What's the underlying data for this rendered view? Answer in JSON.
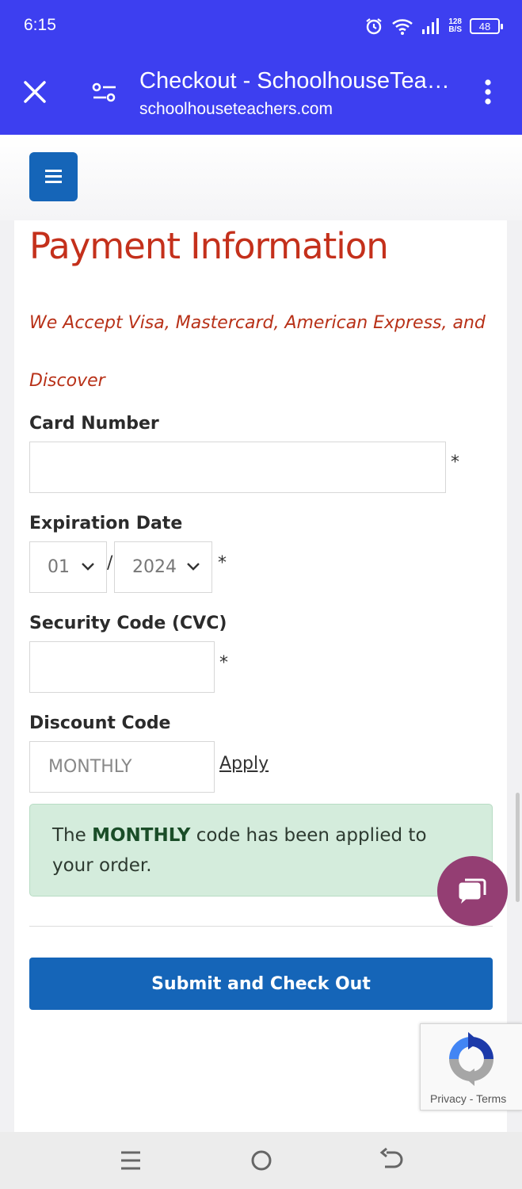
{
  "status_bar": {
    "time": "6:15",
    "net_speed_top": "128",
    "net_speed_bottom": "B/S",
    "battery": "48",
    "icons": [
      "alarm-icon",
      "wifi-icon",
      "signal-icon"
    ]
  },
  "browser": {
    "title": "Checkout - SchoolhouseTeac...",
    "url": "schoolhouseteachers.com",
    "icons": [
      "close-icon",
      "page-settings-icon",
      "more-vert-icon"
    ]
  },
  "site": {
    "menu_icon": "hamburger-icon",
    "accent": "#1565b8"
  },
  "payment": {
    "heading": "Payment Information",
    "accept_line1": "We Accept Visa, Mastercard, American Express, and",
    "accept_line2": "Discover",
    "card_label": "Card Number",
    "card_value": "",
    "expiry_label": "Expiration Date",
    "expiry_month": "01",
    "expiry_slash": "/",
    "expiry_year": "2024",
    "cvc_label": "Security Code (CVC)",
    "cvc_value": "",
    "required_mark": "*",
    "discount_label": "Discount Code",
    "discount_value": "MONTHLY",
    "apply_label": "Apply",
    "alert_prefix": "The",
    "alert_code": "MONTHLY",
    "alert_suffix": "code has been applied to your order.",
    "submit_label": "Submit and Check Out",
    "heading_color": "#c4301b",
    "alert_bg": "#d4ecdc"
  },
  "chat": {
    "icon": "chat-icon",
    "color": "#943e73"
  },
  "recaptcha": {
    "privacy": "Privacy",
    "separator": "-",
    "terms": "Terms"
  },
  "nav": {
    "icons": [
      "recents-icon",
      "home-icon",
      "back-icon"
    ]
  }
}
